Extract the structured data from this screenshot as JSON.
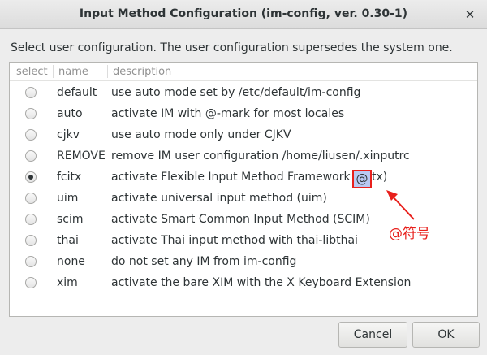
{
  "window": {
    "title": "Input Method Configuration (im-config, ver. 0.30-1)",
    "close_symbol": "✕"
  },
  "instruction": "Select user configuration. The user configuration supersedes the system one.",
  "columns": {
    "select": "select",
    "name": "name",
    "description": "description"
  },
  "rows": [
    {
      "name": "default",
      "description": "use auto mode set by /etc/default/im-config",
      "selected": false
    },
    {
      "name": "auto",
      "description": "activate IM with @-mark for most locales",
      "selected": false
    },
    {
      "name": "cjkv",
      "description": "use auto mode only under CJKV",
      "selected": false
    },
    {
      "name": "REMOVE",
      "description": "remove IM user configuration /home/liusen/.xinputrc",
      "selected": false
    },
    {
      "name": "fcitx",
      "description": "activate Flexible Input Method Framework (fcitx)",
      "selected": true
    },
    {
      "name": "uim",
      "description": "activate universal input method (uim)",
      "selected": false
    },
    {
      "name": "scim",
      "description": "activate Smart Common Input Method (SCIM)",
      "selected": false
    },
    {
      "name": "thai",
      "description": "activate Thai input method with thai-libthai",
      "selected": false
    },
    {
      "name": "none",
      "description": "do not set any IM from im-config",
      "selected": false
    },
    {
      "name": "xim",
      "description": "activate the bare XIM with the X Keyboard Extension",
      "selected": false
    }
  ],
  "annotation": {
    "marked_char": "@",
    "label": "@符号",
    "color": "#e8201c"
  },
  "buttons": {
    "cancel": "Cancel",
    "ok": "OK"
  }
}
